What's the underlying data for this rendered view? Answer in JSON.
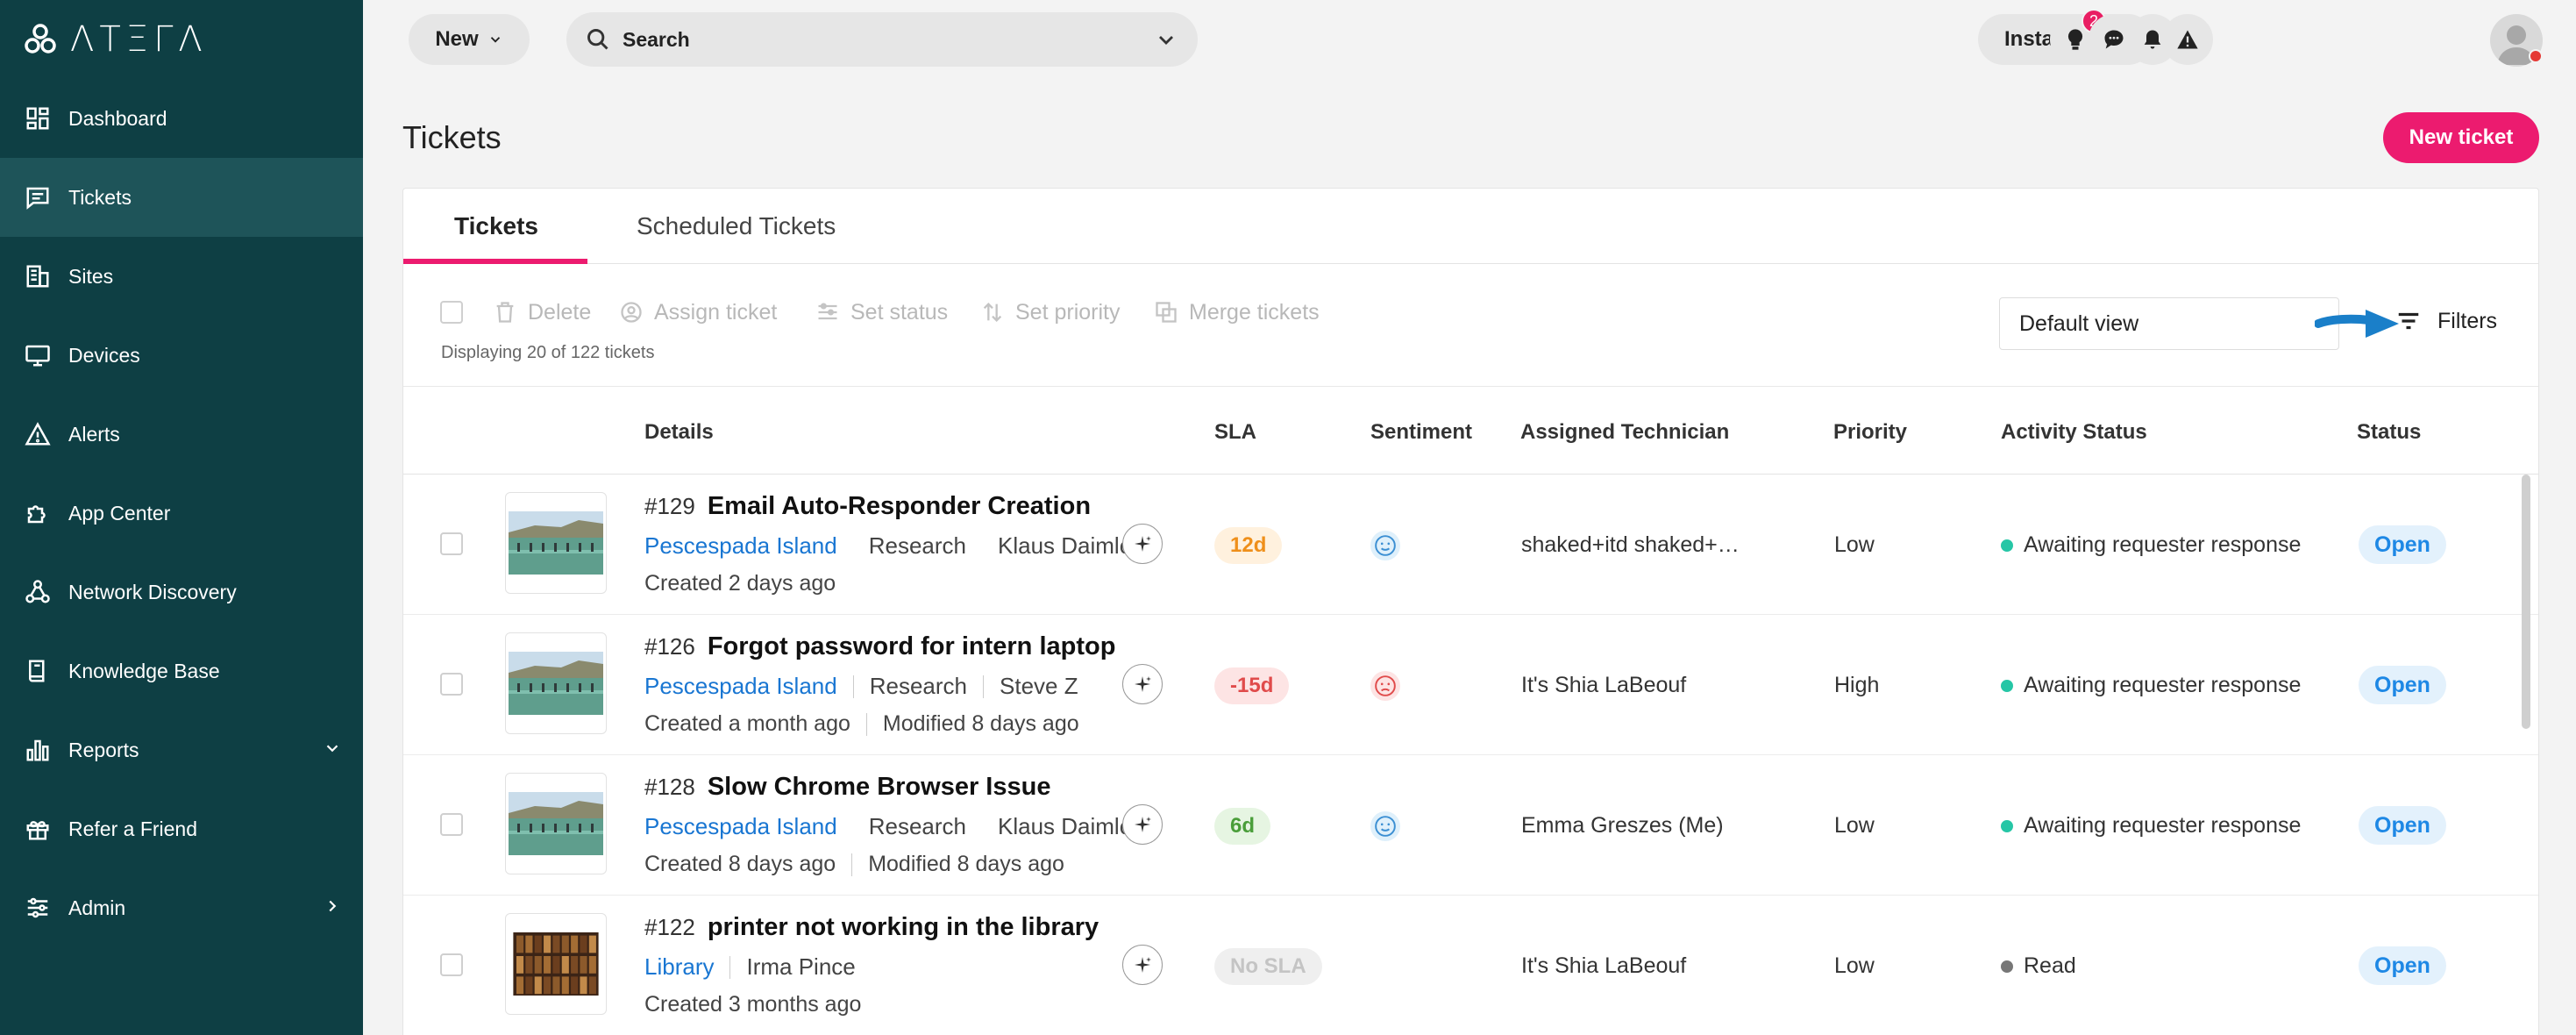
{
  "brand": {
    "logo_text": "ΛΤΞΓΛ",
    "pink": "#ec1b6f",
    "sidebar_bg": "#0e3f44",
    "link_blue": "#1976d2"
  },
  "sidebar": {
    "items": [
      {
        "label": "Dashboard",
        "icon": "dashboard-icon"
      },
      {
        "label": "Tickets",
        "icon": "ticket-icon",
        "active": true
      },
      {
        "label": "Sites",
        "icon": "building-icon"
      },
      {
        "label": "Devices",
        "icon": "monitor-icon"
      },
      {
        "label": "Alerts",
        "icon": "warning-icon"
      },
      {
        "label": "App Center",
        "icon": "puzzle-icon"
      },
      {
        "label": "Network Discovery",
        "icon": "network-icon"
      },
      {
        "label": "Knowledge Base",
        "icon": "book-icon"
      },
      {
        "label": "Reports",
        "icon": "bar-chart-icon",
        "chevron": "chevron-down-icon"
      },
      {
        "label": "Refer a Friend",
        "icon": "gift-icon"
      },
      {
        "label": "Admin",
        "icon": "sliders-icon",
        "chevron": "chevron-right-icon"
      }
    ]
  },
  "topbar": {
    "new_label": "New",
    "search_label": "Search",
    "install_label": "Install agent",
    "notification_count": "2"
  },
  "page": {
    "title": "Tickets",
    "new_ticket_label": "New ticket",
    "tabs": [
      "Tickets",
      "Scheduled Tickets"
    ],
    "toolbar": {
      "delete": "Delete",
      "assign": "Assign ticket",
      "set_status": "Set status",
      "set_priority": "Set priority",
      "merge": "Merge tickets",
      "displaying": "Displaying 20 of 122 tickets",
      "view": "Default view",
      "filters": "Filters"
    },
    "columns": {
      "details": "Details",
      "sla": "SLA",
      "sentiment": "Sentiment",
      "technician": "Assigned Technician",
      "priority": "Priority",
      "activity": "Activity Status",
      "status": "Status"
    }
  },
  "tickets": [
    {
      "num": "#129",
      "title": "Email Auto-Responder Creation",
      "site": "Pescespada Island",
      "dept": "Research",
      "requester": "Klaus Daimler",
      "created": "Created 2 days ago",
      "modified": "",
      "sla": "12d",
      "sla_kind": "warn",
      "sentiment": "neutral",
      "technician": "shaked+itd shaked+itd",
      "priority": "Low",
      "activity": "Awaiting requester response",
      "activity_color": "#26c6a6",
      "status": "Open",
      "thumb": "beach"
    },
    {
      "num": "#126",
      "title": "Forgot password for intern laptop",
      "site": "Pescespada Island",
      "dept": "Research",
      "requester": "Steve Z",
      "created": "Created a month ago",
      "modified": "Modified 8 days ago",
      "sla": "-15d",
      "sla_kind": "bad",
      "sentiment": "sad",
      "technician": "It's Shia LaBeouf",
      "priority": "High",
      "activity": "Awaiting requester response",
      "activity_color": "#26c6a6",
      "status": "Open",
      "thumb": "beach"
    },
    {
      "num": "#128",
      "title": "Slow Chrome Browser Issue",
      "site": "Pescespada Island",
      "dept": "Research",
      "requester": "Klaus Daimler",
      "created": "Created 8 days ago",
      "modified": "Modified 8 days ago",
      "sla": "6d",
      "sla_kind": "good",
      "sentiment": "neutral",
      "technician": "Emma Greszes (Me)",
      "priority": "Low",
      "activity": "Awaiting requester response",
      "activity_color": "#26c6a6",
      "status": "Open",
      "thumb": "beach"
    },
    {
      "num": "#122",
      "title": "printer not working in the library",
      "site": "Library",
      "dept": "",
      "requester": "Irma Pince",
      "created": "Created 3 months ago",
      "modified": "",
      "sla": "No SLA",
      "sla_kind": "none",
      "sentiment": "",
      "technician": "It's Shia LaBeouf",
      "priority": "Low",
      "activity": "Read",
      "activity_color": "#777777",
      "status": "Open",
      "thumb": "library"
    }
  ]
}
